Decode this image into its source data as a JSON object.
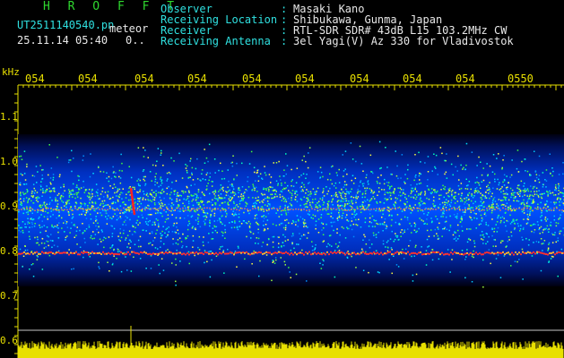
{
  "header": {
    "brand": "H R O F F T",
    "filename": "UT2511140540.pn",
    "event_type": "meteor",
    "timestamp": "25.11.14 05:40",
    "count": "0.."
  },
  "info": [
    {
      "label": "Observer",
      "value": "Masaki Kano"
    },
    {
      "label": "Receiving Location",
      "value": "Shibukawa, Gunma, Japan"
    },
    {
      "label": "Receiver",
      "value": "RTL-SDR SDR# 43dB L15 103.2MHz CW"
    },
    {
      "label": "Receiving Antenna",
      "value": "3el Yagi(V) Az 330 for Vladivostok"
    }
  ],
  "axis": {
    "y_unit": "kHz",
    "y_ticks": [
      "1.1",
      "1.0",
      "0.9",
      "0.8",
      "0.7",
      "0.6"
    ],
    "x_ticks": [
      "054",
      "054",
      "054",
      "054",
      "054",
      "054",
      "054",
      "054",
      "054",
      "0550"
    ]
  },
  "colors": {
    "background": "#000000",
    "axis_text": "#e8e000",
    "brand": "#2fd82f",
    "info_label": "#2fe0e0"
  }
}
